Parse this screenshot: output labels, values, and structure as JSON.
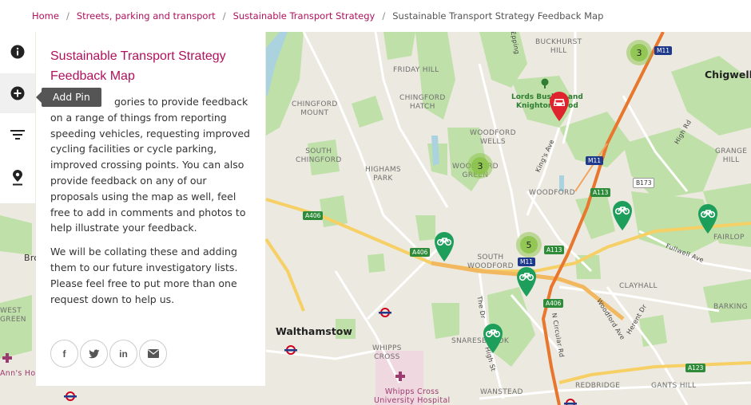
{
  "breadcrumb": {
    "items": [
      "Home",
      "Streets, parking and transport",
      "Sustainable Transport Strategy",
      "Sustainable Transport Strategy Feedback Map"
    ]
  },
  "toolbar": {
    "tooltip": "Add Pin",
    "icons": [
      "info-icon",
      "add-pin-icon",
      "filter-icon",
      "location-icon"
    ]
  },
  "panel": {
    "title": "Sustainable Transport Strategy Feedback Map",
    "para1_visible": "gories to provide feedback on a range of things from reporting speeding vehicles, requesting improved cycling facilities or cycle parking, improved crossing points. You can also provide feedback on any of our proposals using the map as well, feel free to add in comments and photos to help illustrate your feedback.",
    "para2": "We will be collating these and adding them to our future investigatory lists. Please feel free to put more than one request down to help us.",
    "share": [
      "f",
      "t",
      "in",
      "mail"
    ]
  },
  "map": {
    "clusters": [
      {
        "count": "3"
      },
      {
        "count": "3"
      },
      {
        "count": "5"
      }
    ],
    "labels": {
      "chigwell": "Chigwell",
      "walthamstow": "Walthamstow",
      "buckhurst": "BUCKHURST\nHILL",
      "friday": "FRIDAY HILL",
      "chingford_mount": "CHINGFORD\nMOUNT",
      "chingford_hatch": "CHINGFORD\nHATCH",
      "woodford_wells": "WOODFORD\nWELLS",
      "south_chingford": "SOUTH\nCHINGFORD",
      "highams": "HIGHAMS\nPARK",
      "woodford_green": "WOODFORD\nGREEN",
      "woodford": "WOODFORD",
      "south_woodford": "SOUTH\nWOODFORD",
      "grange": "GRANGE\nHILL",
      "fairlop": "FAIRLOP",
      "clayhall": "CLAYHALL",
      "barking": "BARKING",
      "snaresbrook": "SNARESBROOK",
      "wanstead": "WANSTEAD",
      "redbridge": "REDBRIDGE",
      "gants": "GANTS HILL",
      "whipps": "WHIPPS\nCROSS",
      "whipps_hosp": "Whipps Cross\nUniversity Hospital",
      "lords": "Lords Bushes and\nKnighton Wood",
      "kings_ave": "King's Ave",
      "high_rd": "High Rd",
      "fullwell": "Fullwell Ave",
      "woodford_ave": "Woodford Ave",
      "n_circular": "N Circular Rd",
      "high_st": "High St",
      "the_dr": "The Dr",
      "epping": "Epping",
      "herent": "Herent Dr",
      "west_green": "WEST\nGREEN",
      "anns": "Ann's Hos",
      "bro": "Bro"
    },
    "shields": [
      "M11",
      "M11",
      "M11",
      "A406",
      "A406",
      "A406",
      "A113",
      "A113",
      "B173",
      "A123"
    ]
  },
  "colors": {
    "accent": "#b0115d",
    "pin_green": "#1e9e5b",
    "pin_red": "#e0242e",
    "cluster": "#8bc34a"
  }
}
